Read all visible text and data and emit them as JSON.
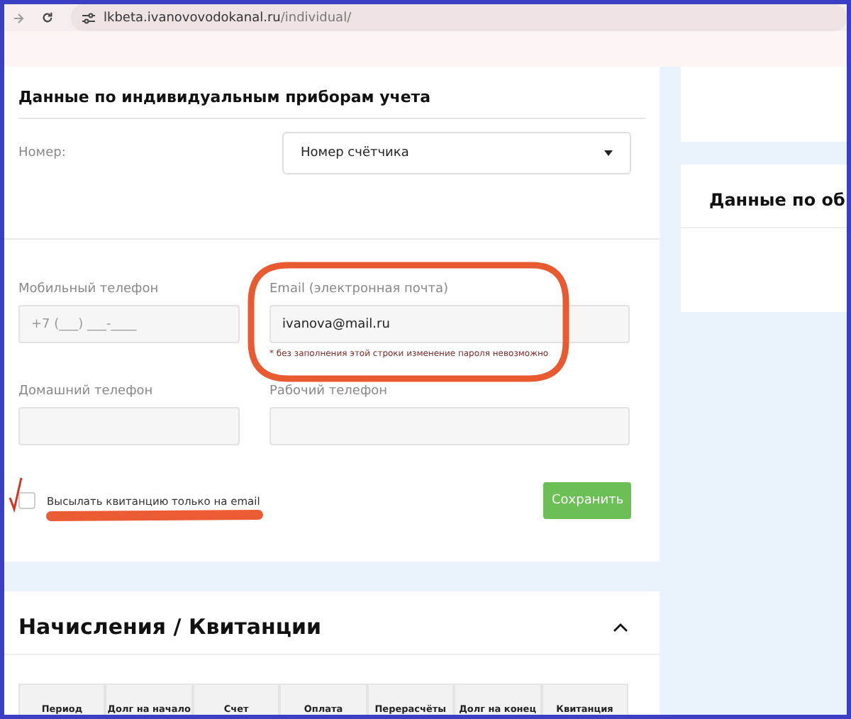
{
  "browser": {
    "url_host": "lkbeta.ivanovovodokanal.ru",
    "url_path": "/individual/"
  },
  "meters": {
    "title": "Данные по индивидуальным приборам учета",
    "number_label": "Номер:",
    "number_select": "Номер счётчика"
  },
  "contacts": {
    "fields": [
      {
        "label": "Мобильный телефон",
        "placeholder": "+7 (___) ___-____"
      },
      {
        "label": "Email (электронная почта)",
        "value": "ivanova@mail.ru",
        "hint": "* без заполнения этой строки изменение пароля невозможно"
      },
      {
        "label": "Домашний телефон"
      },
      {
        "label": "Рабочий телефон"
      }
    ],
    "email_only": {
      "label": "Высылать квитанцию только на email",
      "checked": false
    },
    "save": "Сохранить"
  },
  "charges": {
    "title": "Начисления / Квитанции",
    "expanded": true,
    "columns": [
      "Период",
      "Долг на начало",
      "Счет",
      "Оплата",
      "Перерасчёты",
      "Долг на конец",
      "Квитанция"
    ]
  },
  "side": {
    "card_title": "Данные по об"
  }
}
